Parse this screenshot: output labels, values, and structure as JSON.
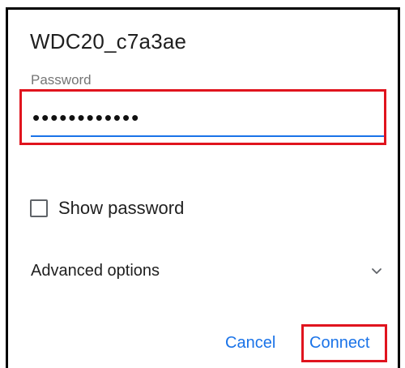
{
  "dialog": {
    "title": "WDC20_c7a3ae",
    "password": {
      "label": "Password",
      "value": "••••••••••••"
    },
    "show_password": {
      "label": "Show password",
      "checked": false
    },
    "advanced": {
      "label": "Advanced options",
      "icon": "chevron-down-icon"
    },
    "actions": {
      "cancel": "Cancel",
      "connect": "Connect"
    }
  },
  "colors": {
    "accent": "#1a73e8",
    "highlight": "#e0141e",
    "text": "#1f1f1f",
    "muted": "#757575"
  }
}
